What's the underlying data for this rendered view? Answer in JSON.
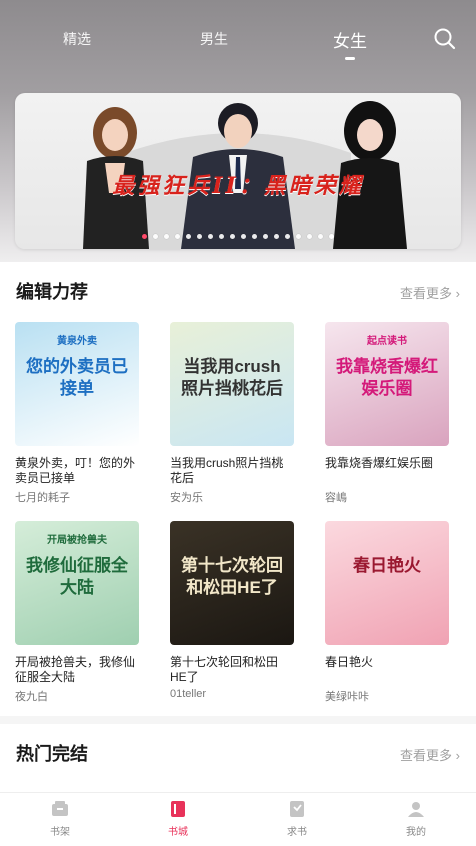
{
  "header": {
    "tabs": [
      {
        "label": "精选"
      },
      {
        "label": "男生"
      },
      {
        "label": "女生",
        "active": true
      }
    ]
  },
  "banner": {
    "title": "最强狂兵II：黑暗荣耀",
    "dot_count": 18,
    "active_dot": 0
  },
  "editor_picks": {
    "title": "编辑力荐",
    "more": "查看更多",
    "books": [
      {
        "title": "黄泉外卖，叮！您的外卖员已接单",
        "author": "七月的耗子",
        "cover_text": "您的外卖员已接单",
        "cover_tag": "黄泉外卖",
        "cover_colors": [
          "#b9e0f2",
          "#ffffff"
        ],
        "accent": "#1d6fc2"
      },
      {
        "title": "当我用crush照片挡桃花后",
        "author": "安为乐",
        "cover_text": "当我用crush照片挡桃花后",
        "cover_colors": [
          "#e8f0d8",
          "#c9e6f3"
        ],
        "accent": "#333333"
      },
      {
        "title": "我靠烧香爆红娱乐圈",
        "author": "容嶋",
        "cover_text": "我靠烧香爆红娱乐圈",
        "cover_tag": "起点读书",
        "cover_colors": [
          "#f6e6ee",
          "#d9a3be"
        ],
        "accent": "#d41a7a"
      },
      {
        "title": "开局被抢兽夫，我修仙征服全大陆",
        "author": "夜九白",
        "cover_text": "我修仙征服全大陆",
        "cover_tag": "开局被抢兽夫",
        "cover_colors": [
          "#d5edd9",
          "#9fcfb0"
        ],
        "accent": "#1f6b3c"
      },
      {
        "title": "第十七次轮回和松田HE了",
        "author": "01teller",
        "cover_text": "第十七次轮回和松田HE了",
        "cover_colors": [
          "#3a3226",
          "#1b1712"
        ],
        "accent": "#f2e7c9"
      },
      {
        "title": "春日艳火",
        "author": "美绿咔咔",
        "cover_text": "春日艳火",
        "cover_colors": [
          "#fbd9df",
          "#f0a2b3"
        ],
        "accent": "#9a1830"
      }
    ]
  },
  "completed": {
    "title": "热门完结",
    "more": "查看更多"
  },
  "bottom_nav": {
    "items": [
      {
        "label": "书架",
        "icon": "bookshelf-icon"
      },
      {
        "label": "书城",
        "icon": "bookstore-icon",
        "active": true
      },
      {
        "label": "求书",
        "icon": "request-icon"
      },
      {
        "label": "我的",
        "icon": "profile-icon"
      }
    ]
  },
  "colors": {
    "accent": "#e8325a",
    "text": "#1a1a1a",
    "muted": "#a0a0a0"
  }
}
